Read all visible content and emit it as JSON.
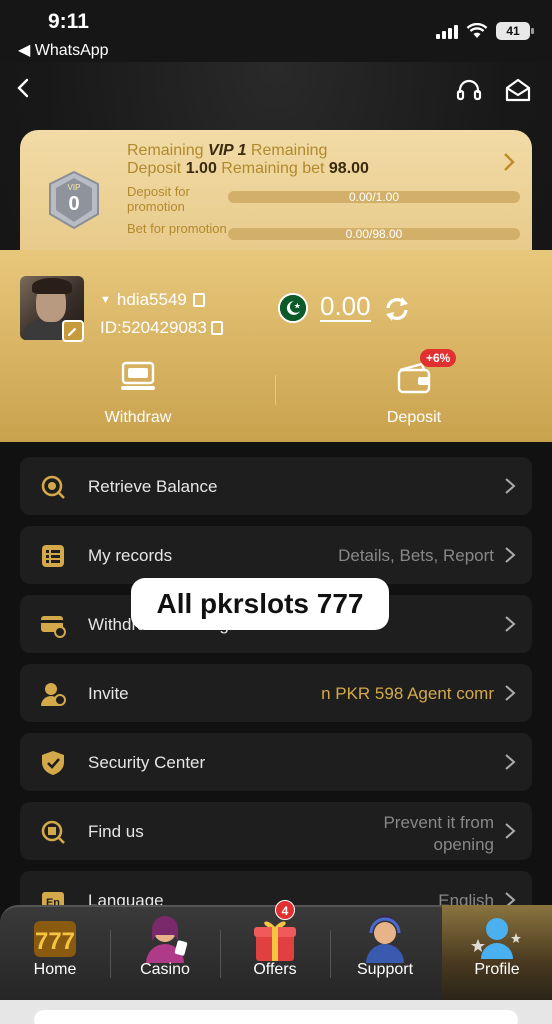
{
  "status_bar": {
    "time": "9:11",
    "back_app": "◀ WhatsApp",
    "battery": "41"
  },
  "vip": {
    "line1_prefix": "Remaining ",
    "line1_level": "VIP 1",
    "line1_suffix": " Remaining",
    "line2_deposit_label": "Deposit ",
    "line2_deposit_value": "1.00",
    "line2_bet_label": " Remaining bet ",
    "line2_bet_value": "98.00",
    "badge_label": "VIP",
    "badge_level": "0",
    "deposit_promo_label": "Deposit for promotion",
    "deposit_progress": "0.00/1.00",
    "deposit_progress_fraction": 0,
    "bet_promo_label": "Bet for promotion",
    "bet_progress": "0.00/98.00",
    "bet_progress_fraction": 0
  },
  "user": {
    "name": "hdia5549",
    "id": "ID:520429083",
    "balance": "0.00"
  },
  "actions": {
    "withdraw": "Withdraw",
    "deposit": "Deposit",
    "deposit_promo": "+6%"
  },
  "menu": [
    {
      "label": "Retrieve Balance",
      "value": ""
    },
    {
      "label": "My records",
      "value": "Details, Bets, Report"
    },
    {
      "label": "Withdrawal management",
      "value": ""
    },
    {
      "label": "Invite",
      "value": "n PKR 598  Agent comr"
    },
    {
      "label": "Security Center",
      "value": ""
    },
    {
      "label": "Find us",
      "value_line1": "Prevent it from",
      "value_line2": "opening"
    },
    {
      "label": "Language",
      "value": "English"
    }
  ],
  "overlay_caption": "All pkrslots 777",
  "nav": {
    "home": "Home",
    "casino": "Casino",
    "offers": "Offers",
    "offers_badge": "4",
    "support": "Support",
    "profile": "Profile"
  },
  "colors": {
    "gold": "#c9a24d",
    "accent_red": "#e03030",
    "menu_bg": "#1e1e1e"
  }
}
